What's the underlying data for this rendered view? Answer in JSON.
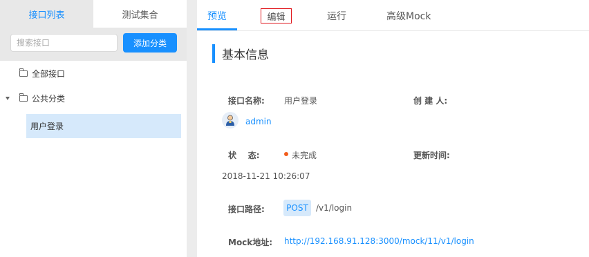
{
  "sidebar": {
    "tabs": [
      {
        "label": "接口列表",
        "active": true
      },
      {
        "label": "测试集合",
        "active": false
      }
    ],
    "search": {
      "placeholder": "搜索接口",
      "value": ""
    },
    "add_button": "添加分类",
    "tree": {
      "all": "全部接口",
      "category": "公共分类",
      "item": "用户登录"
    }
  },
  "main": {
    "tabs": [
      {
        "label": "预览",
        "active": true
      },
      {
        "label": "编辑",
        "active": false
      },
      {
        "label": "运行",
        "active": false
      },
      {
        "label": "高级Mock",
        "active": false
      }
    ],
    "section_title": "基本信息",
    "fields": {
      "name_label": "接口名称:",
      "name_value": "用户登录",
      "creator_label": "创 建 人:",
      "creator_value": "admin",
      "status_label": "状    态:",
      "status_value": "未完成",
      "update_label": "更新时间:",
      "update_value": "2018-11-21 10:26:07",
      "path_label": "接口路径:",
      "method": "POST",
      "path": "/v1/login",
      "mock_label": "Mock地址:",
      "mock_url": "http://192.168.91.128:3000/mock/11/v1/login"
    }
  },
  "colors": {
    "accent": "#1890ff",
    "highlight_border": "#e0151b",
    "status_dot": "#f25d1c",
    "selected_bg": "#d6e9fb"
  },
  "icons": [
    "folder-icon",
    "caret-down-icon",
    "avatar-icon",
    "status-dot-icon"
  ]
}
